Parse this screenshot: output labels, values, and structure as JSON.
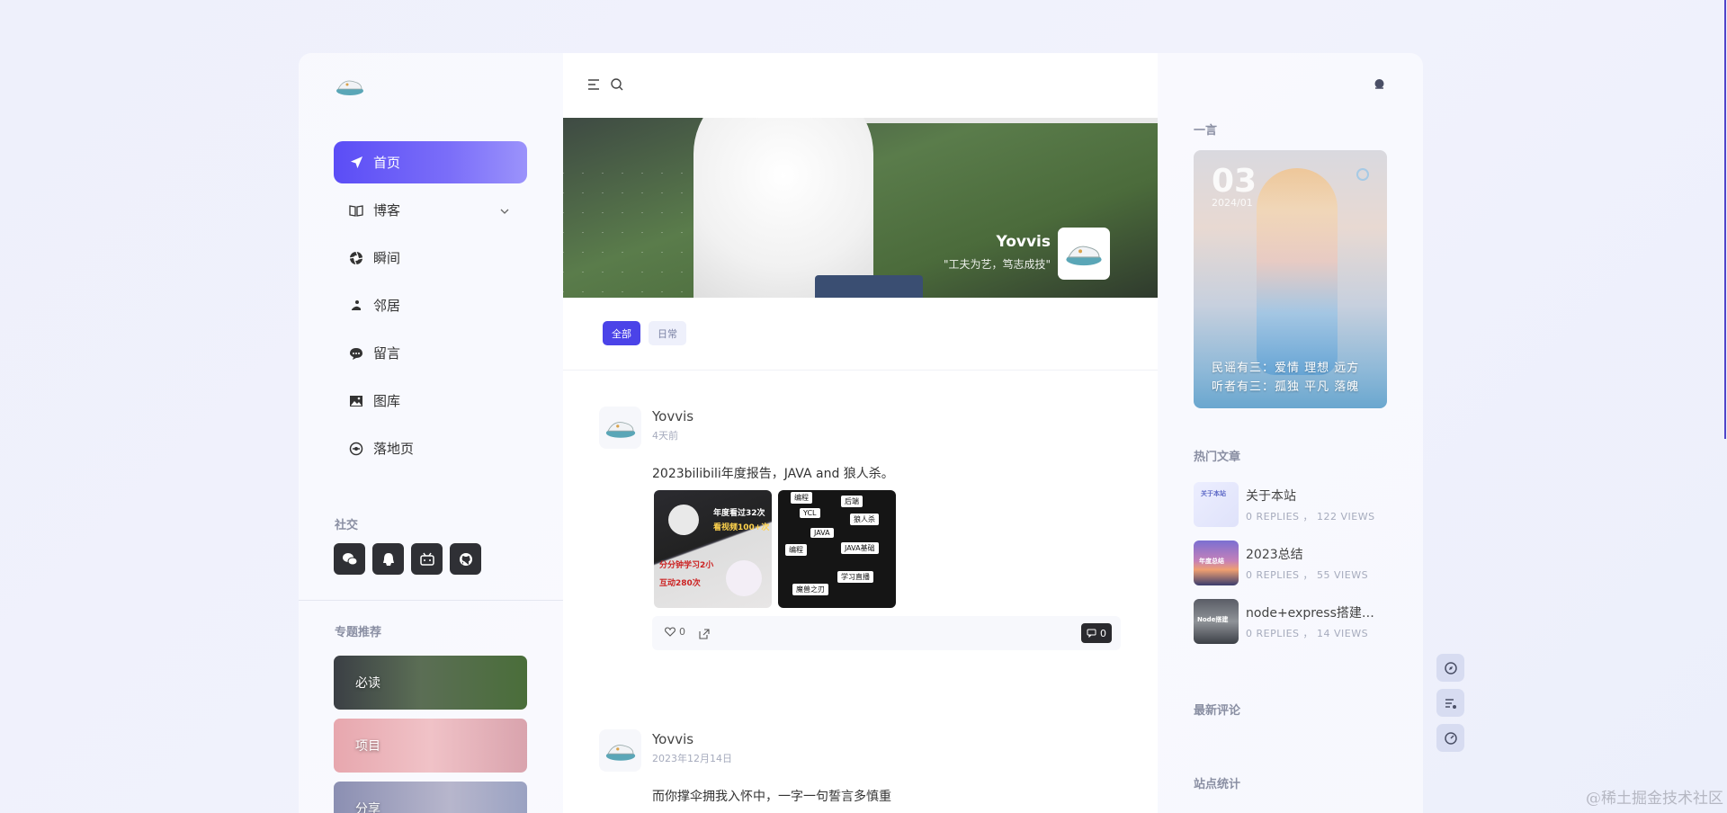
{
  "nav": {
    "items": [
      {
        "label": "首页",
        "icon": "send-icon",
        "active": true
      },
      {
        "label": "博客",
        "icon": "book-icon",
        "has_chevron": true
      },
      {
        "label": "瞬间",
        "icon": "aperture-icon"
      },
      {
        "label": "邻居",
        "icon": "foot-icon"
      },
      {
        "label": "留言",
        "icon": "chat-bubble-icon"
      },
      {
        "label": "图库",
        "icon": "image-icon"
      },
      {
        "label": "落地页",
        "icon": "compass-icon"
      }
    ]
  },
  "social": {
    "title": "社交",
    "icons": [
      "wechat-icon",
      "qq-icon",
      "bilibili-icon",
      "github-icon"
    ]
  },
  "topics": {
    "title": "专题推荐",
    "items": [
      "必读",
      "项目",
      "分享"
    ]
  },
  "banner": {
    "author_name": "Yovvis",
    "motto": "\"工夫为艺，笃志成技\""
  },
  "filters": [
    "全部",
    "日常"
  ],
  "posts": [
    {
      "author": "Yovvis",
      "time": "4天前",
      "text": "2023bilibili年度报告，JAVA and 狼人杀。",
      "image1_labels": [
        "年度看过32次",
        "看视频100+次",
        "分分钟学习2小",
        "互动280次"
      ],
      "image2_labels": [
        "编程",
        "YCL",
        "后端",
        "狼人杀",
        "JAVA",
        "编程",
        "JAVA基础",
        "学习直播",
        "魔兽之刃"
      ],
      "likes": "0",
      "comments": "0"
    },
    {
      "author": "Yovvis",
      "time": "2023年12月14日",
      "text": "而你撑伞拥我入怀中，一字一句誓言多慎重"
    }
  ],
  "right": {
    "quote_title": "一言",
    "quote_day": "03",
    "quote_month": "2024/01",
    "quote_lines": [
      "民谣有三：爱情 理想 远方",
      "听者有三：孤独 平凡 落魄"
    ],
    "hot_title": "热门文章",
    "hot_posts": [
      {
        "title": "关于本站",
        "meta": "0 REPLIES ， 122 VIEWS",
        "thumb_text": "关于本站"
      },
      {
        "title": "2023总结",
        "meta": "0 REPLIES ， 55 VIEWS",
        "thumb_text": "年度总结"
      },
      {
        "title": "node+express搭建简...",
        "meta": "0 REPLIES ， 14 VIEWS",
        "thumb_text": "Node搭建"
      }
    ],
    "comments_title": "最新评论",
    "stats_title": "站点统计"
  },
  "watermark": "@稀土掘金技术社区"
}
